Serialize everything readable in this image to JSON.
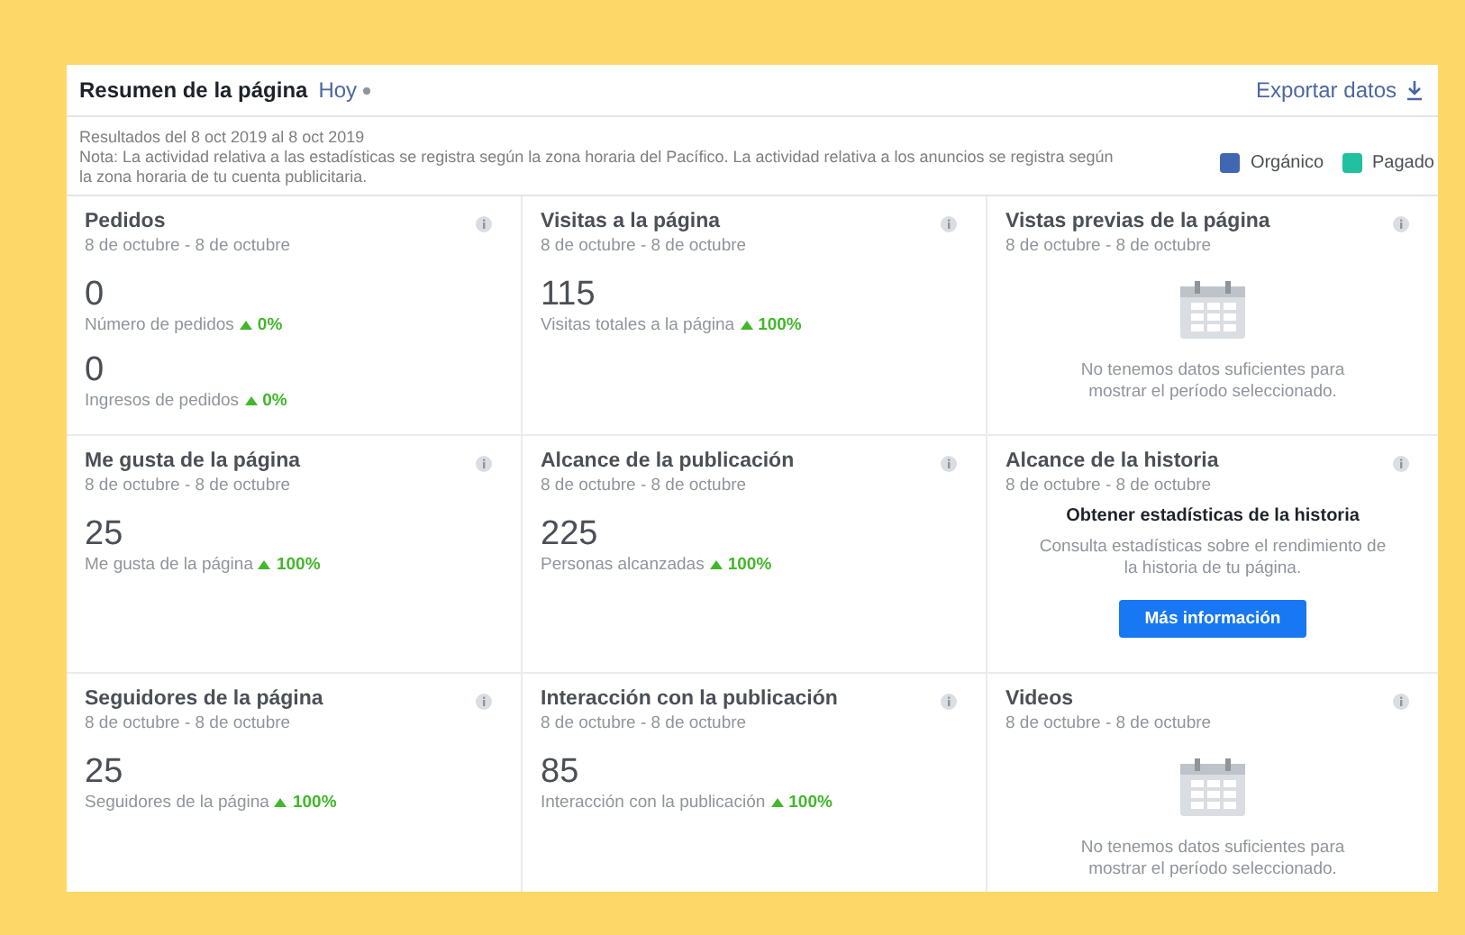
{
  "header": {
    "title": "Resumen de la página",
    "period": "Hoy",
    "export": "Exportar datos"
  },
  "note": {
    "range": "Resultados del 8 oct 2019 al 8 oct 2019",
    "text": "Nota: La actividad relativa a las estadísticas se registra según la zona horaria del Pacífico. La actividad relativa a los anuncios se registra según la zona horaria de tu cuenta publicitaria."
  },
  "legend": [
    {
      "label": "Orgánico",
      "color": "#4267b2"
    },
    {
      "label": "Pagado",
      "color": "#20c0a0"
    }
  ],
  "cards": [
    {
      "kind": "metrics",
      "title": "Pedidos",
      "dates": "8 de octubre - 8 de octubre",
      "metrics": [
        {
          "value": "0",
          "label": "Número de pedidos",
          "change": "0%"
        },
        {
          "value": "0",
          "label": "Ingresos de pedidos",
          "change": "0%"
        }
      ]
    },
    {
      "kind": "metrics",
      "title": "Visitas a la página",
      "dates": "8 de octubre - 8 de octubre",
      "metrics": [
        {
          "value": "115",
          "label": "Visitas totales a la página",
          "change": "100%"
        }
      ]
    },
    {
      "kind": "empty",
      "title": "Vistas previas de la página",
      "dates": "8 de octubre - 8 de octubre",
      "message": "No tenemos datos suficientes para mostrar el período seleccionado."
    },
    {
      "kind": "metrics",
      "title": "Me gusta de la página",
      "dates": "8 de octubre - 8 de octubre",
      "metrics": [
        {
          "value": "25",
          "label": "Me gusta de la página",
          "change": "100%"
        }
      ]
    },
    {
      "kind": "metrics",
      "title": "Alcance de la publicación",
      "dates": "8 de octubre - 8 de octubre",
      "metrics": [
        {
          "value": "225",
          "label": "Personas alcanzadas",
          "change": "100%"
        }
      ]
    },
    {
      "kind": "promo",
      "title": "Alcance de la historia",
      "dates": "8 de octubre - 8 de octubre",
      "heading": "Obtener estadísticas de la historia",
      "message": "Consulta estadísticas sobre el rendimiento de la historia de tu página.",
      "button": "Más información"
    },
    {
      "kind": "metrics",
      "title": "Seguidores de la página",
      "dates": "8 de octubre - 8 de octubre",
      "metrics": [
        {
          "value": "25",
          "label": "Seguidores de la página",
          "change": "100%"
        }
      ]
    },
    {
      "kind": "metrics",
      "title": "Interacción con la publicación",
      "dates": "8 de octubre - 8 de octubre",
      "metrics": [
        {
          "value": "85",
          "label": "Interacción con la publicación",
          "change": "100%"
        }
      ]
    },
    {
      "kind": "empty",
      "title": "Videos",
      "dates": "8 de octubre - 8 de octubre",
      "message": "No tenemos datos suficientes para mostrar el período seleccionado."
    }
  ]
}
